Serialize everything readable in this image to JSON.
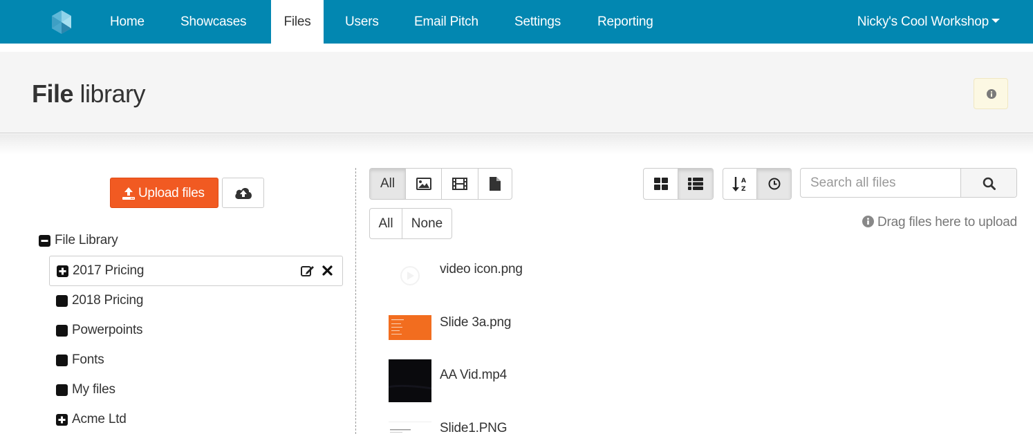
{
  "nav": {
    "items": [
      {
        "label": "Home"
      },
      {
        "label": "Showcases"
      },
      {
        "label": "Files"
      },
      {
        "label": "Users"
      },
      {
        "label": "Email Pitch"
      },
      {
        "label": "Settings"
      },
      {
        "label": "Reporting"
      }
    ],
    "active": "Files",
    "account": "Nicky's Cool Workshop"
  },
  "header": {
    "title_bold": "File",
    "title_rest": "library",
    "info_icon": "info-circle-icon"
  },
  "left": {
    "upload_label": "Upload files",
    "upload_icon": "upload-icon",
    "cloud_icon": "cloud-upload-icon",
    "root_label": "File Library",
    "folders": [
      {
        "label": "2017 Pricing",
        "expand": "plus",
        "selected": true
      },
      {
        "label": "2018 Pricing",
        "expand": "none"
      },
      {
        "label": "Powerpoints",
        "expand": "none"
      },
      {
        "label": "Fonts",
        "expand": "none"
      },
      {
        "label": "My files",
        "expand": "none"
      },
      {
        "label": "Acme Ltd",
        "expand": "plus"
      }
    ]
  },
  "toolbar": {
    "type_filters": [
      {
        "label": "All",
        "active": true
      },
      {
        "icon": "image-icon"
      },
      {
        "icon": "film-icon"
      },
      {
        "icon": "document-icon"
      }
    ],
    "select_all": "All",
    "select_none": "None",
    "view_modes": [
      {
        "icon": "grid-view-icon"
      },
      {
        "icon": "list-view-icon",
        "active": true
      }
    ],
    "sort_modes": [
      {
        "icon": "sort-alpha-icon"
      },
      {
        "icon": "clock-icon",
        "active": true
      }
    ],
    "search_placeholder": "Search all files",
    "drag_hint": "Drag files here to upload"
  },
  "files": [
    {
      "name": "video icon.png"
    },
    {
      "name": "Slide 3a.png"
    },
    {
      "name": "AA Vid.mp4"
    },
    {
      "name": "Slide1.PNG"
    }
  ],
  "colors": {
    "navbar": "#0287b1",
    "upload": "#f15a22",
    "header_bg": "#f5f5f5",
    "info_bg": "#fcf8e3"
  }
}
